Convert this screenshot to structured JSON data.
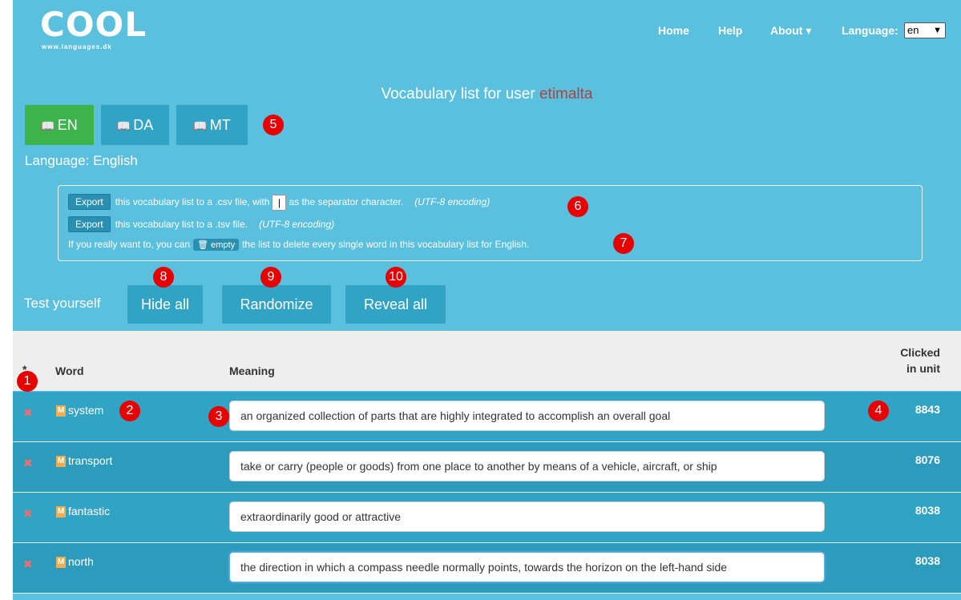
{
  "header": {
    "logo_text": "COOL",
    "logo_sub": "www.languages.dk",
    "nav": {
      "home": "Home",
      "help": "Help",
      "about": "About ▾",
      "language_label": "Language:",
      "language_value": "en"
    }
  },
  "title": {
    "prefix": "Vocabulary list for user ",
    "user": "etimalta"
  },
  "language_buttons": [
    {
      "code": "EN",
      "active": true
    },
    {
      "code": "DA",
      "active": false
    },
    {
      "code": "MT",
      "active": false
    }
  ],
  "language_label": "Language: English",
  "export": {
    "csv": {
      "button": "Export",
      "text_before": "this vocabulary list to a .csv file, with",
      "separator": "|",
      "text_after": "as the separator character.",
      "encoding": "(UTF-8 encoding)"
    },
    "tsv": {
      "button": "Export",
      "text": "this vocabulary list to a .tsv file.",
      "encoding": "(UTF-8 encoding)"
    },
    "empty": {
      "text_before": "If you really want to, you can",
      "button": "🗑 empty",
      "text_after": "the list to delete every single word in this vocabulary list for English."
    }
  },
  "test": {
    "label": "Test yourself",
    "hide_all": "Hide all",
    "randomize": "Randomize",
    "reveal_all": "Reveal all"
  },
  "table": {
    "headers": {
      "star": "*",
      "word": "Word",
      "meaning": "Meaning",
      "clicked_line1": "Clicked",
      "clicked_line2": "in unit"
    },
    "rows": [
      {
        "word": "system",
        "meaning": "an organized collection of parts that are highly integrated to accomplish an overall goal",
        "clicked": "8843"
      },
      {
        "word": "transport",
        "meaning": "take or carry (people or goods) from one place to another by means of a vehicle, aircraft, or ship",
        "clicked": "8076"
      },
      {
        "word": "fantastic",
        "meaning": "extraordinarily good or attractive",
        "clicked": "8038"
      },
      {
        "word": "north",
        "meaning": "the direction in which a compass needle normally points, towards the horizon on the left-hand side",
        "clicked": "8038"
      }
    ]
  },
  "markers": [
    "1",
    "2",
    "3",
    "4",
    "5",
    "6",
    "7",
    "8",
    "9",
    "10"
  ],
  "colors": {
    "background": "#5bc0de",
    "button": "#31a4c6",
    "active_button": "#3cb44b",
    "username": "#a94442",
    "marker": "#e60000"
  }
}
